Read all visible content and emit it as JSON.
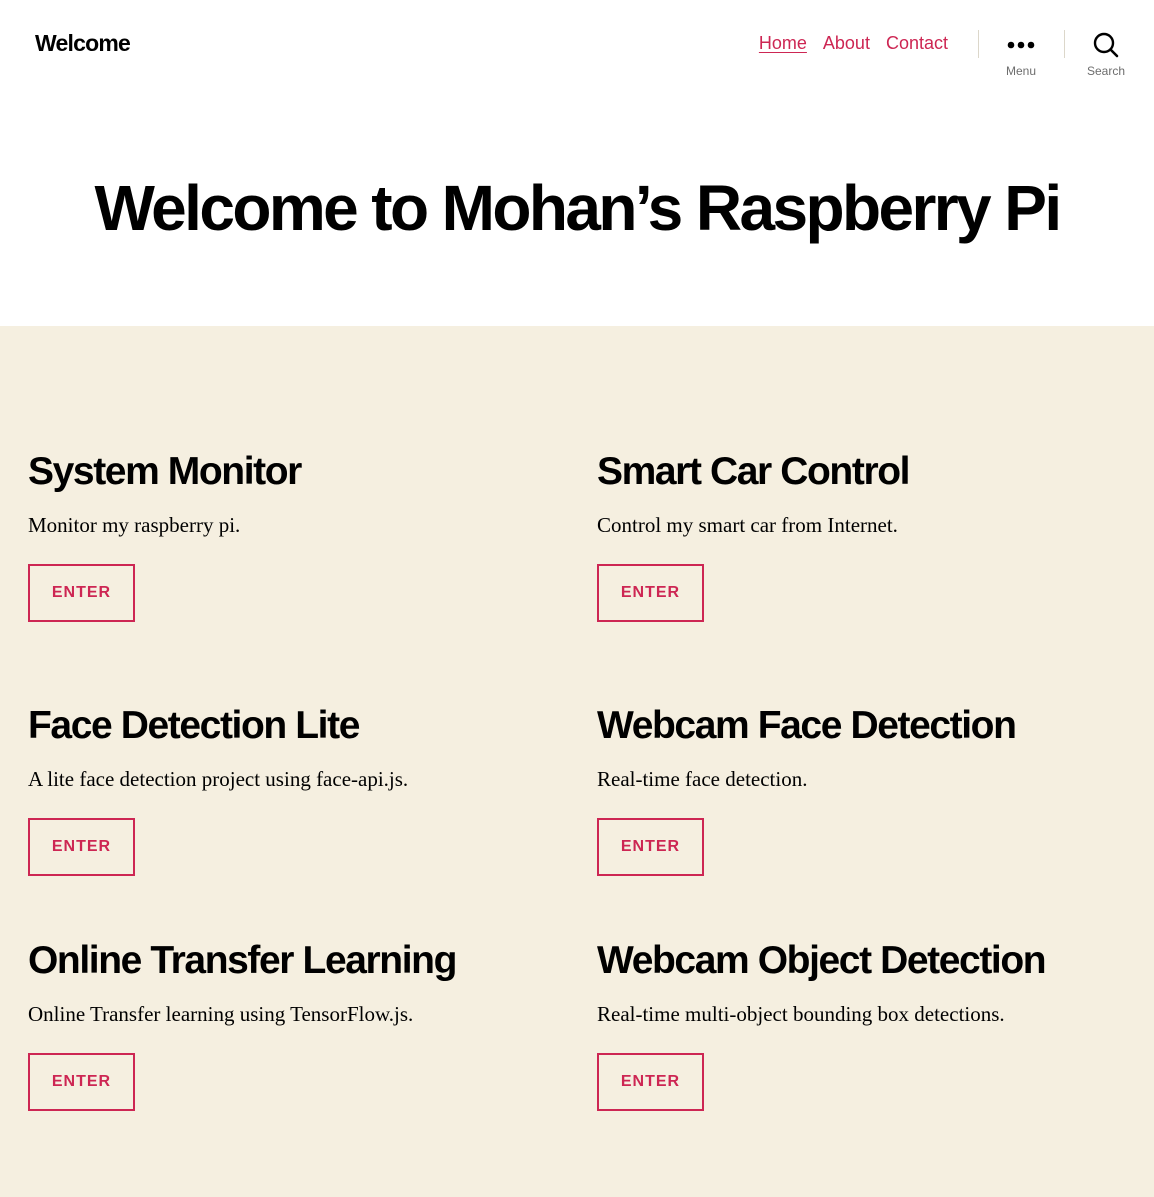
{
  "header": {
    "site_title": "Welcome",
    "nav": [
      {
        "label": "Home",
        "current": true
      },
      {
        "label": "About"
      },
      {
        "label": "Contact"
      }
    ],
    "menu_label": "Menu",
    "search_label": "Search",
    "menu_icon": "ellipsis-icon",
    "search_icon": "search-icon"
  },
  "hero": {
    "title": "Welcome to Mohan’s Raspberry Pi"
  },
  "projects": [
    {
      "title": "System Monitor",
      "description": "Monitor my raspberry pi.",
      "button": "ENTER"
    },
    {
      "title": "Smart Car Control",
      "description": "Control my smart car from Internet.",
      "button": "ENTER"
    },
    {
      "title": "Face Detection Lite",
      "description": "A lite face detection project using face-api.js.",
      "button": "ENTER"
    },
    {
      "title": "Webcam Face Detection",
      "description": "Real-time face detection.",
      "button": "ENTER"
    },
    {
      "title": "Online Transfer Learning",
      "description": "Online Transfer learning using TensorFlow.js.",
      "button": "ENTER"
    },
    {
      "title": "Webcam Object Detection",
      "description": "Real-time multi-object bounding box detections.",
      "button": "ENTER"
    }
  ],
  "colors": {
    "accent": "#cd2653",
    "content_background": "#f5efe0",
    "separator": "#dcd7ca"
  }
}
